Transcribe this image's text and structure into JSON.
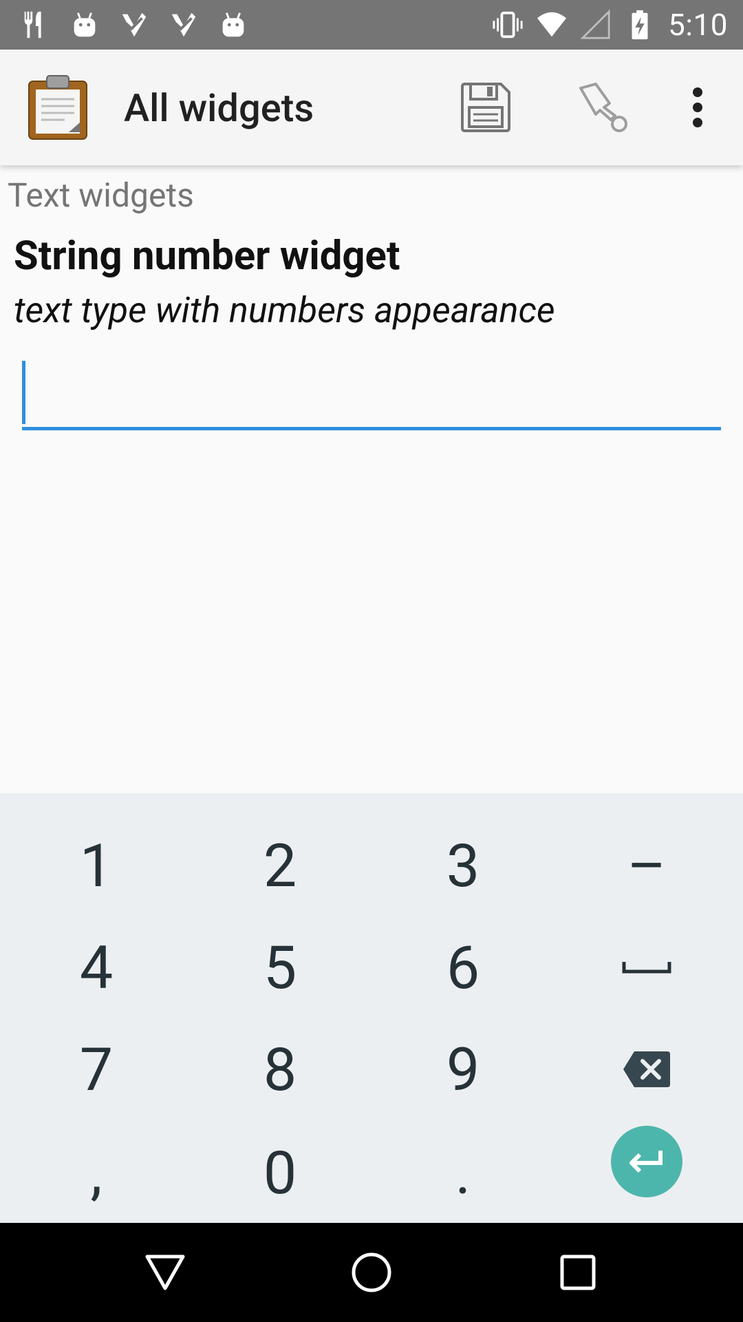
{
  "status_bar": {
    "time": "5:10",
    "left_icons": [
      "restaurant-icon",
      "android-icon",
      "check-icon",
      "check-icon",
      "android-icon"
    ],
    "right_icons": [
      "vibrate-icon",
      "wifi-icon",
      "signal-icon",
      "battery-charging-icon"
    ]
  },
  "app_bar": {
    "title": "All widgets",
    "icons": [
      "clipboard-logo",
      "save-icon",
      "goto-icon",
      "more-vert-icon"
    ]
  },
  "form": {
    "group_label": "Text widgets",
    "question_label": "String number widget",
    "question_hint": "text type with numbers appearance",
    "answer_value": ""
  },
  "keyboard": {
    "keys": [
      [
        "1",
        "2",
        "3",
        "–"
      ],
      [
        "4",
        "5",
        "6",
        "␣"
      ],
      [
        "7",
        "8",
        "9",
        "backspace"
      ],
      [
        ",",
        "0",
        ".",
        "enter"
      ]
    ]
  },
  "nav_bar": {
    "icons": [
      "back-icon",
      "home-icon",
      "recents-icon"
    ]
  },
  "colors": {
    "status_bar": "#757575",
    "accent": "#2f8fde",
    "enter_key": "#4db6ac",
    "keyboard_bg": "#eceff1"
  }
}
